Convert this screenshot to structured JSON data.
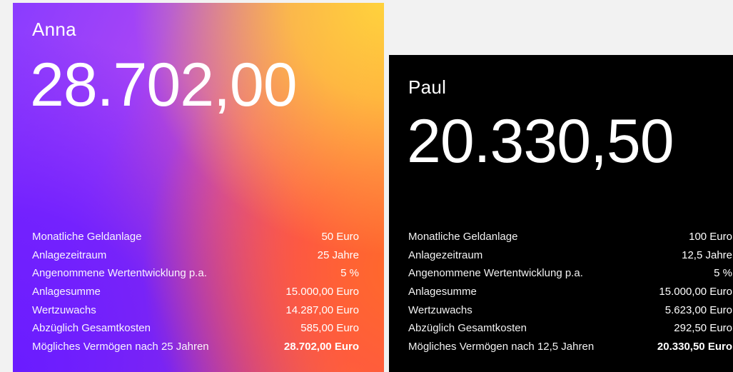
{
  "anna": {
    "name": "Anna",
    "amount": "28.702,00",
    "rows": [
      {
        "label": "Monatliche Geldanlage",
        "value": "50 Euro"
      },
      {
        "label": "Anlagezeitraum",
        "value": "25 Jahre"
      },
      {
        "label": "Angenommene Wertentwicklung p.a.",
        "value": "5 %"
      },
      {
        "label": "Anlagesumme",
        "value": "15.000,00 Euro"
      },
      {
        "label": "Wertzuwachs",
        "value": "14.287,00 Euro"
      },
      {
        "label": "Abzüglich Gesamtkosten",
        "value": "585,00 Euro"
      },
      {
        "label": "Mögliches Vermögen nach 25 Jahren",
        "value": "28.702,00 Euro"
      }
    ]
  },
  "paul": {
    "name": "Paul",
    "amount": "20.330,50",
    "rows": [
      {
        "label": "Monatliche Geldanlage",
        "value": "100 Euro"
      },
      {
        "label": "Anlagezeitraum",
        "value": "12,5 Jahre"
      },
      {
        "label": "Angenommene Wertentwicklung p.a.",
        "value": "5 %"
      },
      {
        "label": "Anlagesumme",
        "value": "15.000,00 Euro"
      },
      {
        "label": "Wertzuwachs",
        "value": "5.623,00 Euro"
      },
      {
        "label": "Abzüglich Gesamtkosten",
        "value": "292,50 Euro"
      },
      {
        "label": "Mögliches Vermögen nach 12,5 Jahren",
        "value": "20.330,50 Euro"
      }
    ]
  },
  "colors": {
    "anna_gradient": [
      "#8a3cff",
      "#e95b9a",
      "#ff7a2e",
      "#ffd23c"
    ],
    "paul_background": "#000000",
    "text": "#ffffff"
  }
}
